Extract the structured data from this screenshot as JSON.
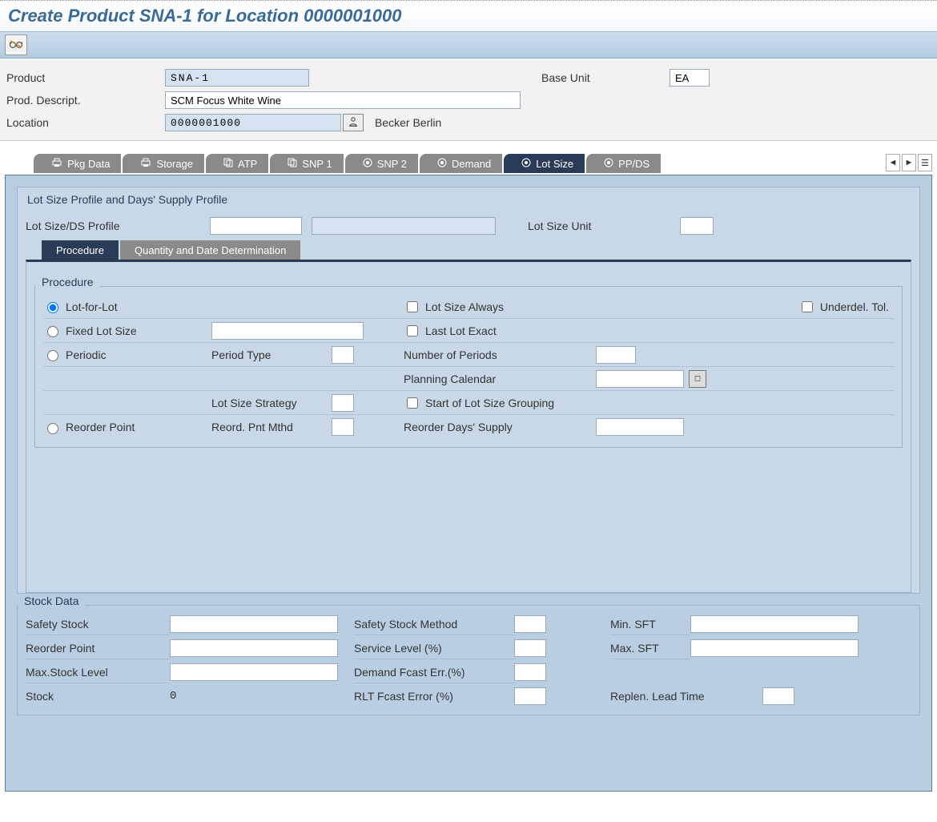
{
  "title": "Create Product SNA-1 for Location 0000001000",
  "header": {
    "product_label": "Product",
    "product_value": "SNA-1",
    "base_unit_label": "Base Unit",
    "base_unit_value": "EA",
    "desc_label": "Prod. Descript.",
    "desc_value": "SCM Focus White Wine",
    "location_label": "Location",
    "location_value": "0000001000",
    "location_text": "Becker Berlin"
  },
  "tabs": {
    "pkg": "Pkg Data",
    "storage": "Storage",
    "atp": "ATP",
    "snp1": "SNP 1",
    "snp2": "SNP 2",
    "demand": "Demand",
    "lotsize": "Lot Size",
    "ppds": "PP/DS"
  },
  "lot_profile": {
    "group_title": "Lot Size Profile and Days' Supply Profile",
    "profile_label": "Lot Size/DS Profile",
    "unit_label": "Lot Size Unit"
  },
  "inner_tabs": {
    "procedure": "Procedure",
    "qdd": "Quantity and Date Determination"
  },
  "procedure": {
    "title": "Procedure",
    "lot_for_lot": "Lot-for-Lot",
    "lot_size_always": "Lot Size Always",
    "underdel_tol": "Underdel. Tol.",
    "fixed_lot_size": "Fixed Lot Size",
    "last_lot_exact": "Last Lot Exact",
    "periodic": "Periodic",
    "period_type": "Period Type",
    "num_periods": "Number of Periods",
    "planning_calendar": "Planning Calendar",
    "lot_size_strategy": "Lot Size Strategy",
    "start_group": "Start of Lot Size Grouping",
    "reorder_point": "Reorder Point",
    "reord_pnt_mthd": "Reord. Pnt Mthd",
    "reorder_days": "Reorder Days' Supply"
  },
  "stock": {
    "title": "Stock Data",
    "safety_stock": "Safety Stock",
    "reorder_point": "Reorder Point",
    "max_stock": "Max.Stock Level",
    "stock_label": "Stock",
    "stock_value": "0",
    "safety_method": "Safety Stock Method",
    "service_level": "Service Level (%)",
    "demand_fcast": "Demand Fcast Err.(%)",
    "rlt_fcast": "RLT Fcast Error (%)",
    "min_sft": "Min. SFT",
    "max_sft": "Max. SFT",
    "replen_lead": "Replen. Lead Time"
  }
}
